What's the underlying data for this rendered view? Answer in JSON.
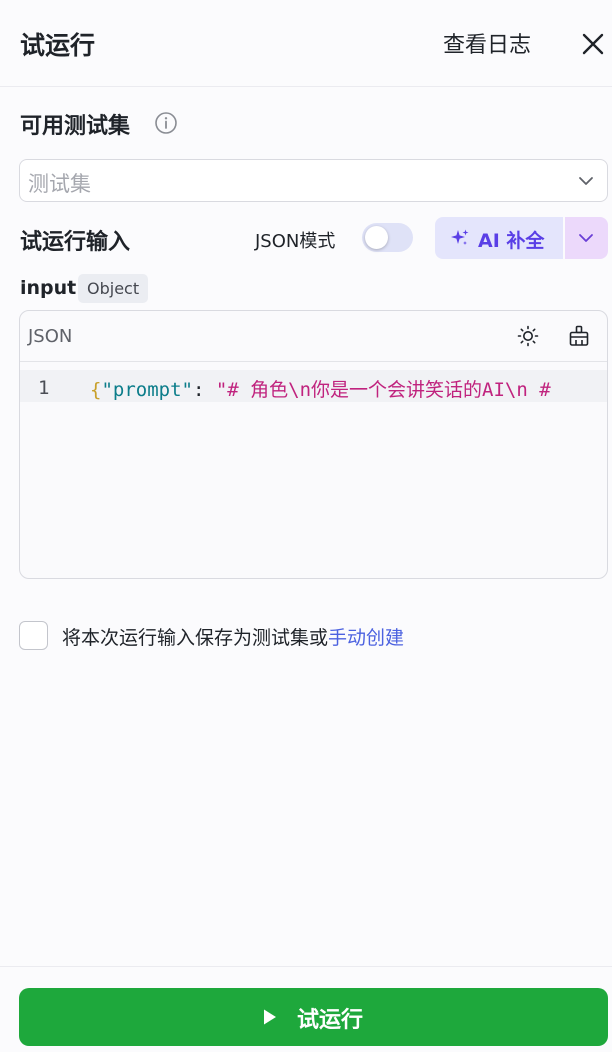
{
  "header": {
    "title": "试运行",
    "view_log": "查看日志"
  },
  "test_set": {
    "label": "可用测试集",
    "placeholder": "测试集"
  },
  "run_input": {
    "label": "试运行输入",
    "json_mode_label": "JSON模式",
    "json_mode_on": false,
    "ai_label": "AI 补全"
  },
  "variable": {
    "name": "input",
    "type": "Object"
  },
  "editor": {
    "language": "JSON",
    "line_number": "1",
    "code": {
      "open_brace": "{",
      "key": "\"prompt\"",
      "colon": ": ",
      "value": "\"# 角色\\n你是一个会讲笑话的AI\\n #"
    }
  },
  "save": {
    "text": "将本次运行输入保存为测试集或",
    "link": "手动创建",
    "checked": false
  },
  "footer": {
    "run_label": "试运行"
  },
  "colors": {
    "primary_green": "#1ea83c",
    "ai_purple": "#5a3fe6",
    "link_blue": "#4c62e0"
  }
}
